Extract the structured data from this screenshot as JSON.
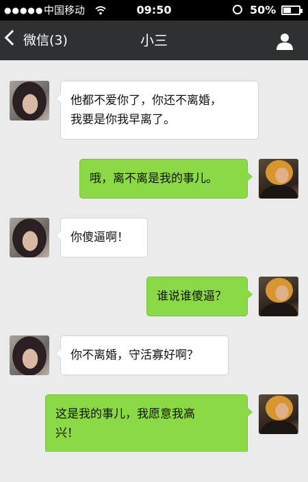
{
  "status_bar": {
    "signal": "●●●●●",
    "carrier": "中国移动",
    "wifi_icon": "wifi-icon",
    "time": "09:50",
    "battery_percent": "50%",
    "battery_level": 0.5
  },
  "nav": {
    "back_label": "微信(3)",
    "title": "小三",
    "contact_icon": "person-icon"
  },
  "messages": [
    {
      "side": "in",
      "lines": [
        "他都不爱你了，你还不离婚，",
        "我要是你我早离了。"
      ]
    },
    {
      "side": "out",
      "lines": [
        "哦，离不离是我的事儿。"
      ]
    },
    {
      "side": "in",
      "lines": [
        "你傻逼啊！"
      ]
    },
    {
      "side": "out",
      "lines": [
        "谁说谁傻逼？"
      ]
    },
    {
      "side": "in",
      "lines": [
        "你不离婚，守活寡好啊？"
      ]
    },
    {
      "side": "out",
      "lines": [
        "这是我的事儿，我愿意我高",
        "兴！"
      ]
    }
  ],
  "colors": {
    "status_bar_bg": "#000000",
    "nav_bg": "#2e3132",
    "chat_bg": "#ebebeb",
    "bubble_in": "#ffffff",
    "bubble_out": "#8bda45"
  }
}
